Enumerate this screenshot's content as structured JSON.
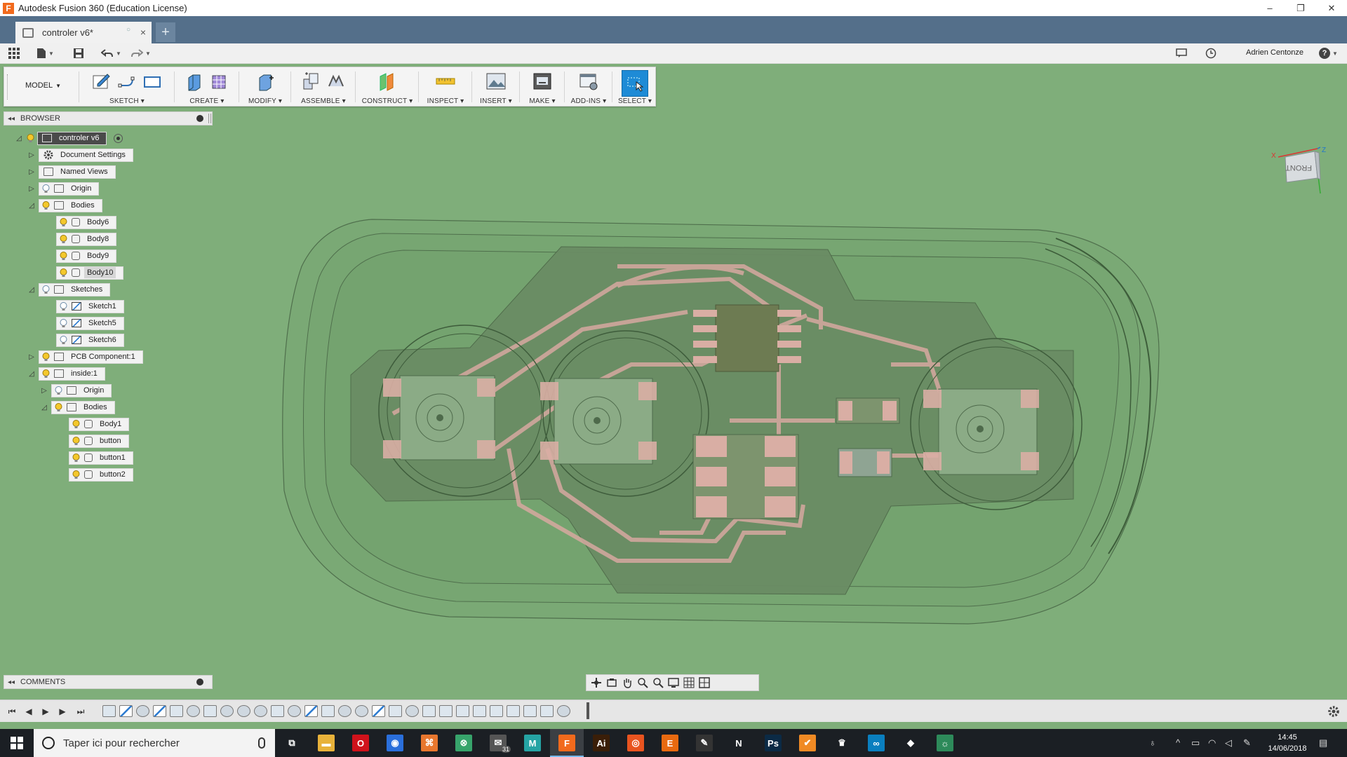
{
  "window": {
    "app_icon_letter": "F",
    "title": "Autodesk Fusion 360 (Education License)",
    "controls": [
      "–",
      "❐",
      "✕"
    ]
  },
  "document_tab": {
    "label": "controler v6*",
    "close": "×",
    "new_tab": "+"
  },
  "quickbar": {
    "user_name": "Adrien Centonze",
    "help": "?"
  },
  "toolbar": {
    "workspace": "MODEL",
    "groups": [
      {
        "label": "SKETCH ▾"
      },
      {
        "label": "CREATE ▾"
      },
      {
        "label": "MODIFY ▾"
      },
      {
        "label": "ASSEMBLE ▾"
      },
      {
        "label": "CONSTRUCT ▾"
      },
      {
        "label": "INSPECT ▾"
      },
      {
        "label": "INSERT ▾"
      },
      {
        "label": "MAKE ▾"
      },
      {
        "label": "ADD-INS ▾"
      },
      {
        "label": "SELECT ▾"
      }
    ]
  },
  "browser": {
    "title": "BROWSER",
    "items": [
      {
        "label": "controler v6"
      },
      {
        "label": "Document Settings"
      },
      {
        "label": "Named Views"
      },
      {
        "label": "Origin"
      },
      {
        "label": "Bodies"
      },
      {
        "label": "Body6"
      },
      {
        "label": "Body8"
      },
      {
        "label": "Body9"
      },
      {
        "label": "Body10"
      },
      {
        "label": "Sketches"
      },
      {
        "label": "Sketch1"
      },
      {
        "label": "Sketch5"
      },
      {
        "label": "Sketch6"
      },
      {
        "label": "PCB Component:1"
      },
      {
        "label": "inside:1"
      },
      {
        "label": "Origin"
      },
      {
        "label": "Bodies"
      },
      {
        "label": "Body1"
      },
      {
        "label": "button"
      },
      {
        "label": "button1"
      },
      {
        "label": "button2"
      }
    ]
  },
  "viewcube": {
    "face": "FRONT",
    "axis_x": "X",
    "axis_z": "Z"
  },
  "comments": {
    "title": "COMMENTS"
  },
  "taskbar": {
    "search_placeholder": "Taper ici pour rechercher",
    "time": "14:45",
    "date": "14/06/2018",
    "mail_badge": "31",
    "apps": [
      {
        "name": "task-view",
        "glyph": "⧉",
        "color": "#1b1f24"
      },
      {
        "name": "file-explorer",
        "glyph": "▬",
        "color": "#e8b23a"
      },
      {
        "name": "opera",
        "glyph": "O",
        "color": "#d0121b"
      },
      {
        "name": "firefox",
        "glyph": "◉",
        "color": "#2a6fdb"
      },
      {
        "name": "app-orange",
        "glyph": "⌘",
        "color": "#e8772e"
      },
      {
        "name": "app-green",
        "glyph": "⊗",
        "color": "#37a46b"
      },
      {
        "name": "mail",
        "glyph": "✉",
        "color": "#555"
      },
      {
        "name": "app-m",
        "glyph": "M",
        "color": "#25a4a4"
      },
      {
        "name": "fusion",
        "glyph": "F",
        "color": "#f26a1c"
      },
      {
        "name": "illustrator",
        "glyph": "Ai",
        "color": "#3a1e08"
      },
      {
        "name": "ubuntu",
        "glyph": "◎",
        "color": "#e9541f"
      },
      {
        "name": "eagle",
        "glyph": "E",
        "color": "#e86a10"
      },
      {
        "name": "inkscape",
        "glyph": "✎",
        "color": "#333"
      },
      {
        "name": "netflix",
        "glyph": "N",
        "color": "#1b1f24"
      },
      {
        "name": "photoshop",
        "glyph": "Ps",
        "color": "#0b2a45"
      },
      {
        "name": "app-check",
        "glyph": "✔",
        "color": "#f08a24"
      },
      {
        "name": "app-crown",
        "glyph": "♛",
        "color": "#1b1f24"
      },
      {
        "name": "arduino",
        "glyph": "∞",
        "color": "#0a7fbf"
      },
      {
        "name": "gitkraken",
        "glyph": "◆",
        "color": "#1b1f24"
      },
      {
        "name": "app-chameleon",
        "glyph": "☼",
        "color": "#2d8a5a"
      }
    ]
  }
}
